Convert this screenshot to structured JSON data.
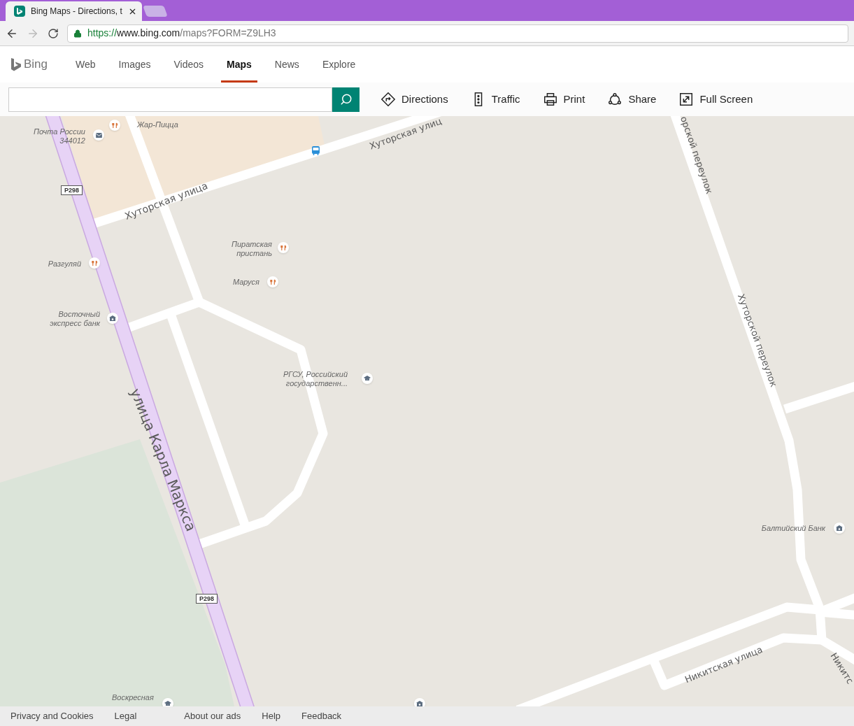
{
  "browser": {
    "tab_title": "Bing Maps - Directions, t",
    "url_secure": "https://www.bing.com",
    "url_path": "/maps?FORM=Z9LH3"
  },
  "nav": {
    "logo": "Bing",
    "items": [
      {
        "label": "Web",
        "selected": false
      },
      {
        "label": "Images",
        "selected": false
      },
      {
        "label": "Videos",
        "selected": false
      },
      {
        "label": "Maps",
        "selected": true
      },
      {
        "label": "News",
        "selected": false
      },
      {
        "label": "Explore",
        "selected": false
      }
    ]
  },
  "toolbar": [
    {
      "label": "Directions",
      "kind": "directions"
    },
    {
      "label": "Traffic",
      "kind": "traffic"
    },
    {
      "label": "Print",
      "kind": "print"
    },
    {
      "label": "Share",
      "kind": "share"
    },
    {
      "label": "Full Screen",
      "kind": "fullscreen"
    }
  ],
  "map": {
    "streets": [
      "Хуторская улиц",
      "Хуторская улица",
      "улица Карла Маркса",
      "орской переулок",
      "Хуторской переулок",
      "Никитская улица",
      "Никитс"
    ],
    "shields": [
      "P298",
      "P298"
    ],
    "pois": [
      {
        "name": "Почта России\n344012",
        "kind": "post"
      },
      {
        "name": "Жар-Пицца",
        "kind": "restaurant"
      },
      {
        "name": "Разгуляй",
        "kind": "restaurant"
      },
      {
        "name": "Восточный\nэкспресс банк",
        "kind": "bank"
      },
      {
        "name": "Пиратская\nпристань",
        "kind": "restaurant"
      },
      {
        "name": "Маруся",
        "kind": "restaurant"
      },
      {
        "name": "РГСУ, Российский\nгосударственн...",
        "kind": "school"
      },
      {
        "name": "Балтийский Банк",
        "kind": "bank"
      },
      {
        "name": "Воскресная",
        "kind": "school"
      },
      {
        "kind": "bus"
      },
      {
        "kind": "bank"
      }
    ]
  },
  "footer": [
    "Privacy and Cookies",
    "Legal",
    "About our ads",
    "Help",
    "Feedback"
  ]
}
